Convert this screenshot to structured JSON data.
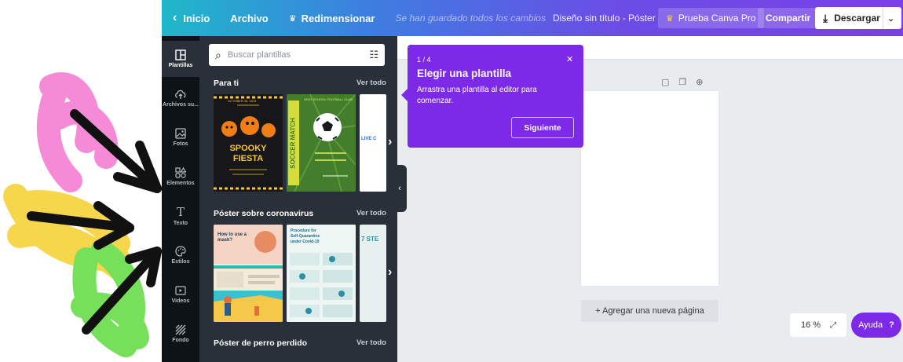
{
  "topbar": {
    "back_label": "Inicio",
    "file_label": "Archivo",
    "resize_label": "Redimensionar",
    "saved_status": "Se han guardado todos los cambios",
    "design_title": "Diseño sin título - Póster",
    "pro_label": "Prueba Canva Pro",
    "share_label": "Compartir",
    "download_label": "Descargar"
  },
  "rail": {
    "items": [
      {
        "label": "Plantillas",
        "icon": "template-icon"
      },
      {
        "label": "Archivos su...",
        "icon": "upload-cloud-icon"
      },
      {
        "label": "Fotos",
        "icon": "photo-icon"
      },
      {
        "label": "Elementos",
        "icon": "shapes-icon"
      },
      {
        "label": "Texto",
        "icon": "text-icon"
      },
      {
        "label": "Estilos",
        "icon": "palette-icon"
      },
      {
        "label": "Videos",
        "icon": "video-icon"
      },
      {
        "label": "Fondo",
        "icon": "background-icon"
      }
    ]
  },
  "panel": {
    "search_placeholder": "Buscar plantillas",
    "sections": [
      {
        "title": "Para ti",
        "more": "Ver todo"
      },
      {
        "title": "Póster sobre coronavirus",
        "more": "Ver todo"
      },
      {
        "title": "Póster de perro perdido",
        "more": "Ver todo"
      }
    ],
    "thumbs": {
      "spooky_date": "OCTOBER 30, 2019",
      "spooky_title1": "SPOOKY",
      "spooky_title2": "FIESTA",
      "soccer_side": "SOCCER MATCH",
      "soccer_top": "HIGH SCHOOL FOOTBALL CLUB",
      "live_text": "LIVE C",
      "mask_title1": "How to use a",
      "mask_title2": "mask?",
      "quarantine_title1": "Procedure for",
      "quarantine_title2": "Self-Quarantine",
      "quarantine_title3": "under Covid-19",
      "steps_text": "7 STE"
    }
  },
  "tooltip": {
    "step": "1 / 4",
    "title": "Elegir una plantilla",
    "body": "Arrastra una plantilla al editor para comenzar.",
    "next_label": "Siguiente"
  },
  "canvas": {
    "add_page_label": "+ Agregar una nueva página",
    "zoom_value": "16 %",
    "help_label": "Ayuda"
  },
  "colors": {
    "accent": "#7d2ae8",
    "panel_bg": "#293039",
    "rail_bg": "#0e1318"
  }
}
